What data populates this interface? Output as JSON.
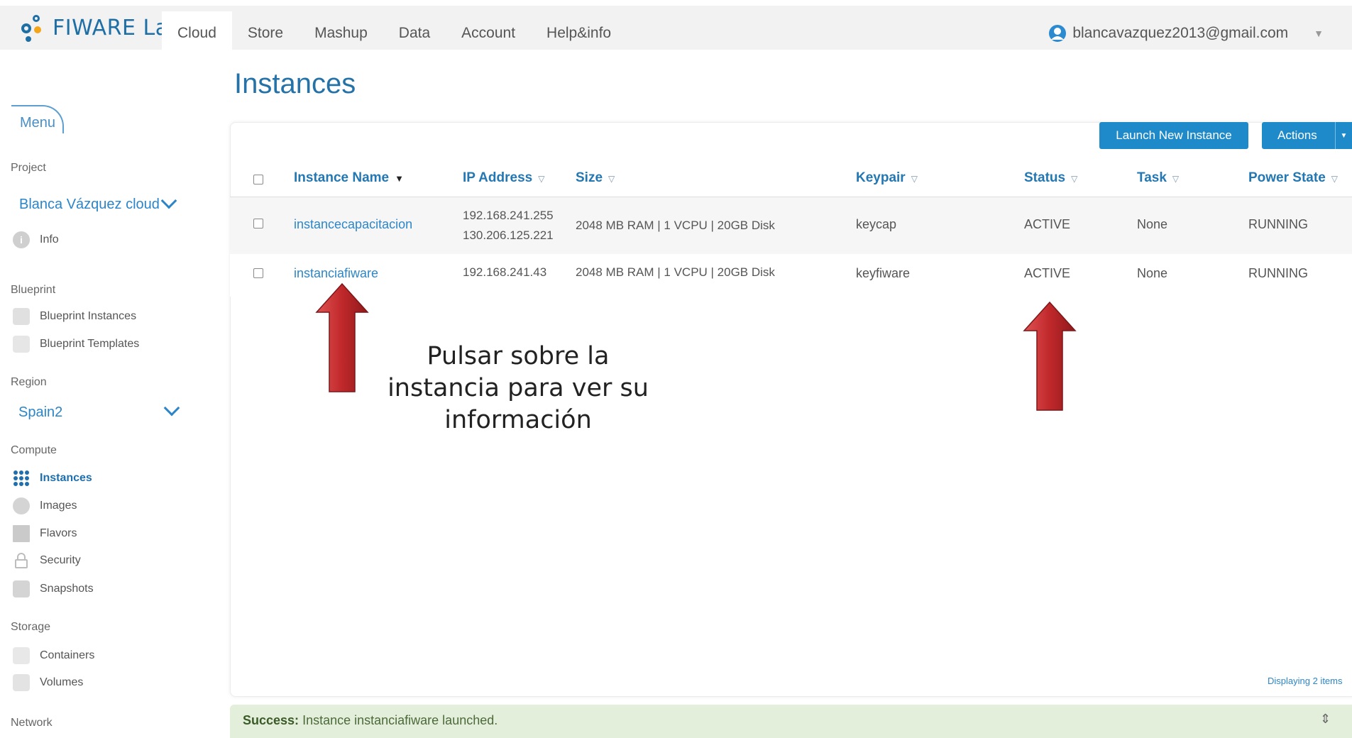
{
  "app": {
    "logo_text": "FIWARE Lab"
  },
  "nav": {
    "items": [
      {
        "label": "Cloud"
      },
      {
        "label": "Store"
      },
      {
        "label": "Mashup"
      },
      {
        "label": "Data"
      },
      {
        "label": "Account"
      },
      {
        "label": "Help&info"
      }
    ]
  },
  "user": {
    "email": "blancavazquez2013@gmail.com"
  },
  "sidebar": {
    "menu_label": "Menu",
    "project_label": "Project",
    "project_value": "Blanca Vázquez cloud",
    "info_label": "Info",
    "blueprint_label": "Blueprint",
    "blueprint_instances": "Blueprint Instances",
    "blueprint_templates": "Blueprint Templates",
    "region_label": "Region",
    "region_value": "Spain2",
    "compute_label": "Compute",
    "instances": "Instances",
    "images": "Images",
    "flavors": "Flavors",
    "security": "Security",
    "snapshots": "Snapshots",
    "storage_label": "Storage",
    "containers": "Containers",
    "volumes": "Volumes",
    "network_label": "Network"
  },
  "main": {
    "title": "Instances",
    "launch_label": "Launch New Instance",
    "actions_label": "Actions",
    "columns": {
      "name": "Instance Name",
      "ip": "IP Address",
      "size": "Size",
      "keypair": "Keypair",
      "status": "Status",
      "task": "Task",
      "power": "Power State"
    },
    "rows": [
      {
        "name": "instancecapacitacion",
        "ip1": "192.168.241.255",
        "ip2": "130.206.125.221",
        "size": "2048 MB RAM | 1 VCPU | 20GB Disk",
        "keypair": "keycap",
        "status": "ACTIVE",
        "task": "None",
        "power": "RUNNING"
      },
      {
        "name": "instanciafiware",
        "ip1": "192.168.241.43",
        "size": "2048 MB RAM | 1 VCPU | 20GB Disk",
        "keypair": "keyfiware",
        "status": "ACTIVE",
        "task": "None",
        "power": "RUNNING"
      }
    ],
    "footer": "Displaying 2 items"
  },
  "success": {
    "label": "Success:",
    "message": "Instance instanciafiware launched."
  },
  "annotation": {
    "line1": "Pulsar sobre la",
    "line2": "instancia para ver su",
    "line3": "información"
  },
  "colors": {
    "accent": "#1e8ac9",
    "arrow": "#c0282b",
    "success_bg": "#e4efdb"
  }
}
